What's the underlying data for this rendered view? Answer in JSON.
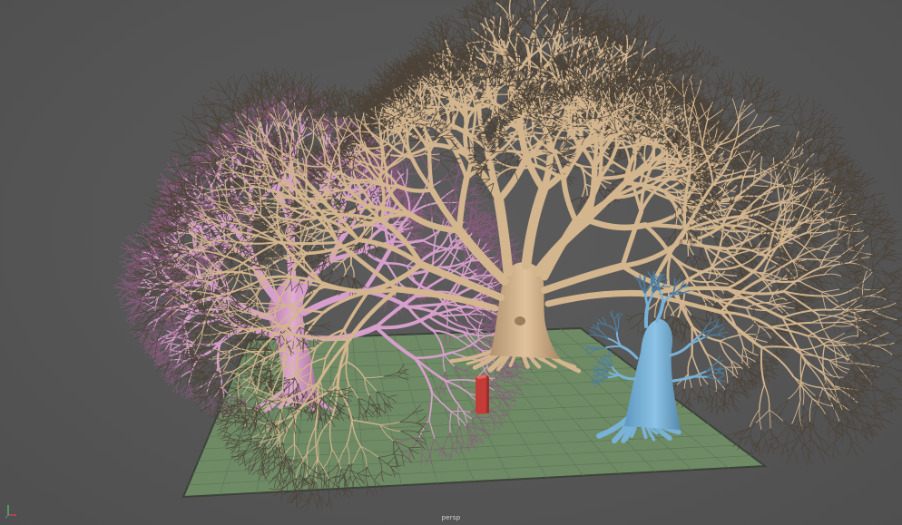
{
  "viewport": {
    "camera_label": "persp",
    "colors": {
      "background": "#555555",
      "ground_fill": "#6f8b66",
      "ground_grid": "#5d7656",
      "ground_border": "#3c4339",
      "tree_pink": "#d79fcb",
      "tree_tan": "#d3b58e",
      "tree_blue": "#79b2d8",
      "red_box": "#c9403c"
    }
  },
  "icons": {
    "axis_gizmo": "axis-gizmo-icon"
  }
}
